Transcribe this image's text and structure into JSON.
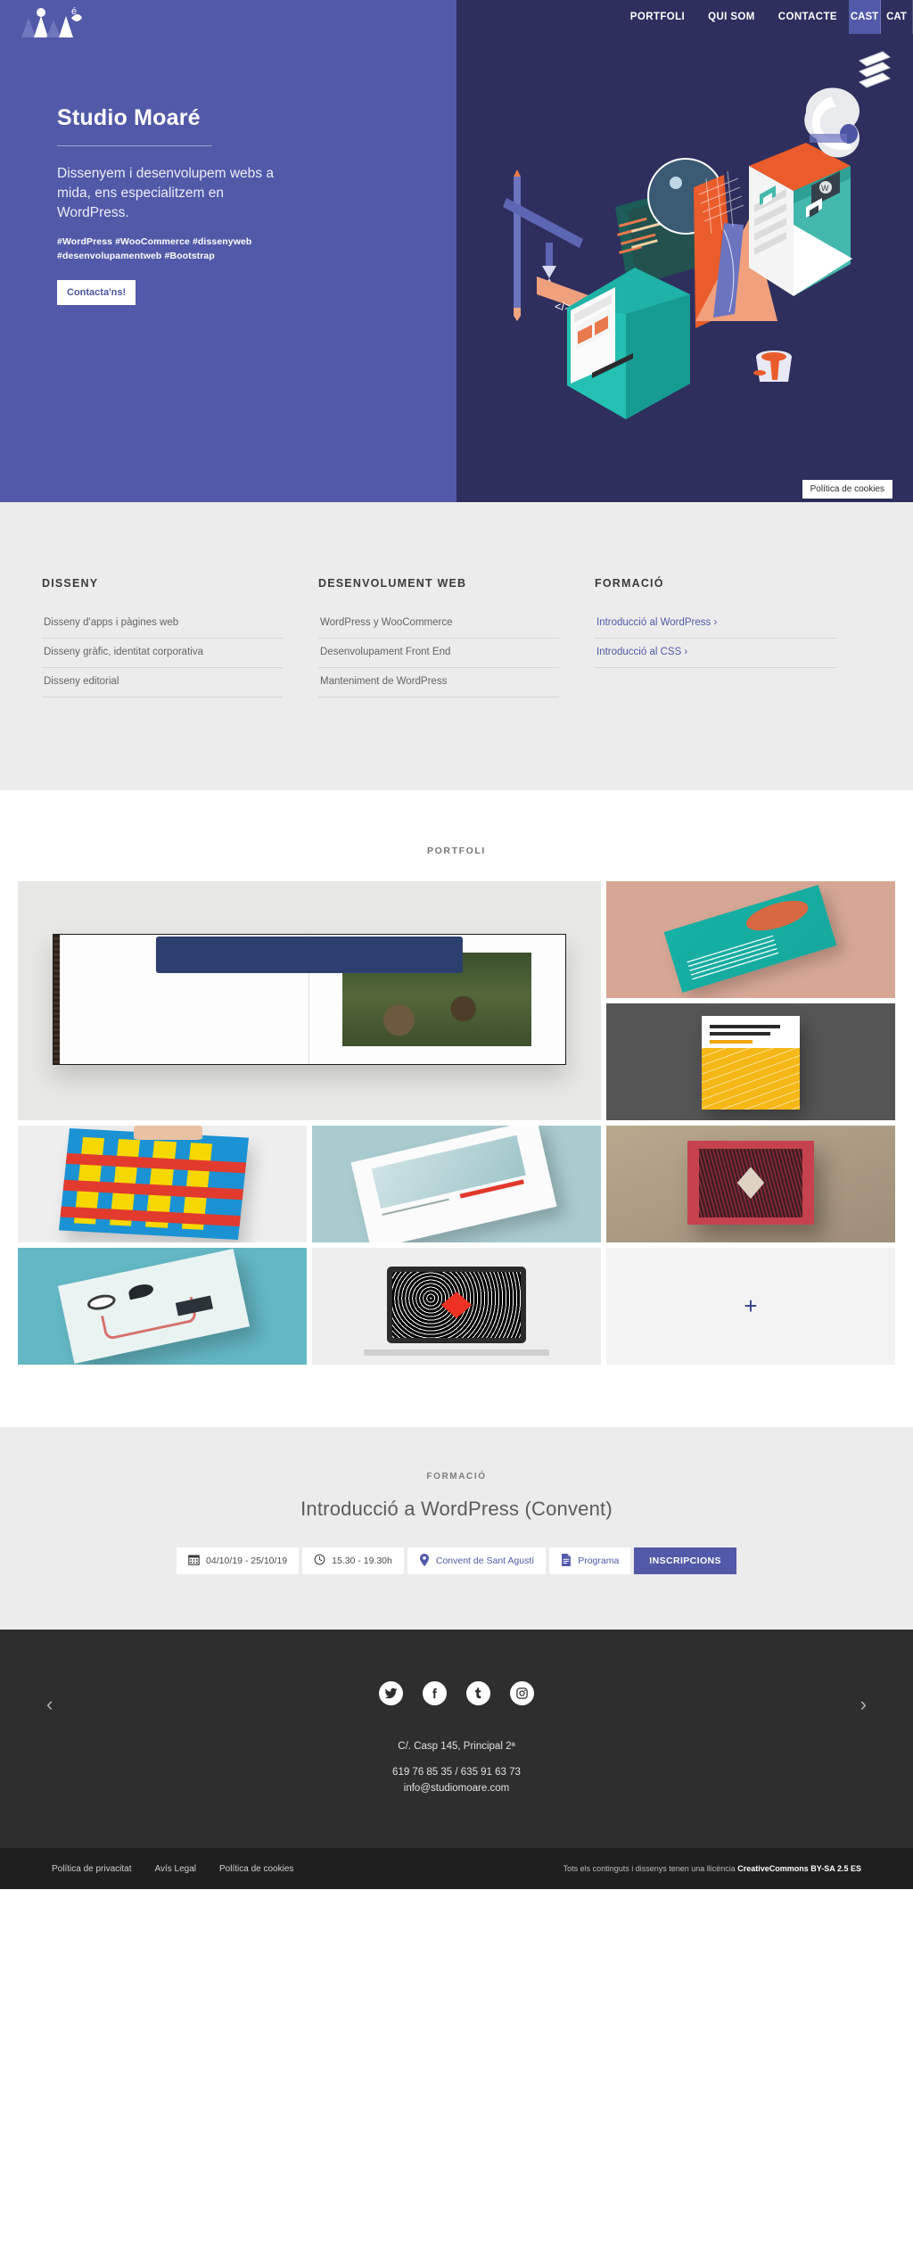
{
  "brand": {
    "logo_name": "studio-moare-logo"
  },
  "colors": {
    "hero_left": "#5159a8",
    "hero_right": "#2e2f5e",
    "accent": "#5159a8",
    "services_bg": "#ececec",
    "footer_bg": "#2e2e2e"
  },
  "nav": {
    "items": [
      {
        "label": "PORTFOLI",
        "name": "nav-portfoli"
      },
      {
        "label": "QUI SOM",
        "name": "nav-qui-som"
      },
      {
        "label": "CONTACTE",
        "name": "nav-contacte"
      }
    ],
    "languages": [
      {
        "label": "CAST",
        "active": true
      },
      {
        "label": "CAT",
        "active": false
      }
    ]
  },
  "hero": {
    "title": "Studio Moaré",
    "subtitle": "Dissenyem i desenvolupem webs a mida, ens especialitzem en WordPress.",
    "tags": "#WordPress #WooCommerce #dissenyweb #desenvolupamentweb #Bootstrap",
    "cta": "Contacta'ns!",
    "cookie_tooltip": "Política de cookies"
  },
  "services": {
    "columns": [
      {
        "heading": "DISSENY",
        "items": [
          {
            "label": "Disseny d'apps i pàgines web",
            "link": false
          },
          {
            "label": "Disseny gràfic, identitat corporativa",
            "link": false
          },
          {
            "label": "Disseny editorial",
            "link": false
          }
        ]
      },
      {
        "heading": "DESENVOLUMENT WEB",
        "items": [
          {
            "label": "WordPress y WooCommerce",
            "link": false
          },
          {
            "label": "Desenvolupament Front End",
            "link": false
          },
          {
            "label": "Manteniment de WordPress",
            "link": false
          }
        ]
      },
      {
        "heading": "FORMACIÓ",
        "items": [
          {
            "label": "Introducció al WordPress ›",
            "link": true
          },
          {
            "label": "Introducció al CSS ›",
            "link": true
          }
        ]
      }
    ]
  },
  "portfolio": {
    "label": "PORTFOLI",
    "items": [
      {
        "name": "portfolio-item-book-spread",
        "alt": "Open photo book spread with boots photograph"
      },
      {
        "name": "portfolio-item-teal-booklet",
        "alt": "Teal booklet on pink background"
      },
      {
        "name": "portfolio-item-yellow-guide",
        "alt": "Yellow guide brochure on grey background"
      },
      {
        "name": "portfolio-item-bam-poster",
        "alt": "BAM Cultura Viva blue and yellow poster"
      },
      {
        "name": "portfolio-item-magazine",
        "alt": "Illustrated programme magazine on blue background"
      },
      {
        "name": "portfolio-item-red-poster",
        "alt": "Red poster with diamond cutout"
      },
      {
        "name": "portfolio-item-cyan-magazine",
        "alt": "Magazine on cyan background"
      },
      {
        "name": "portfolio-item-laptop",
        "alt": "Laptop showing black and red diamond artwork"
      }
    ],
    "more_label": "+"
  },
  "formacio": {
    "label": "FORMACIÓ",
    "title": "Introducció a WordPress (Convent)",
    "meta": [
      {
        "icon": "calendar-icon",
        "text": "04/10/19 - 25/10/19",
        "link": false
      },
      {
        "icon": "clock-icon",
        "text": "15.30 - 19.30h",
        "link": false
      },
      {
        "icon": "map-pin-icon",
        "text": "Convent de Sant Agustí",
        "link": true
      },
      {
        "icon": "document-icon",
        "text": "Programa",
        "link": true
      }
    ],
    "cta": "INSCRIPCIONS",
    "prev": "‹",
    "next": "›"
  },
  "footer": {
    "social": [
      {
        "name": "twitter-icon",
        "label": "Twitter"
      },
      {
        "name": "facebook-icon",
        "label": "Facebook"
      },
      {
        "name": "tumblr-icon",
        "label": "Tumblr"
      },
      {
        "name": "instagram-icon",
        "label": "Instagram"
      }
    ],
    "address": "C/. Casp 145, Principal 2ª",
    "phones": "619 76 85 35 / 635 91 63 73",
    "email": "info@studiomoare.com",
    "legal_links": [
      "Política de privacitat",
      "Avís Legal",
      "Política de cookies"
    ],
    "license_prefix": "Tots els continguts i dissenys tenen una llicència ",
    "license_name": "CreativeCommons BY-SA 2.5 ES"
  }
}
